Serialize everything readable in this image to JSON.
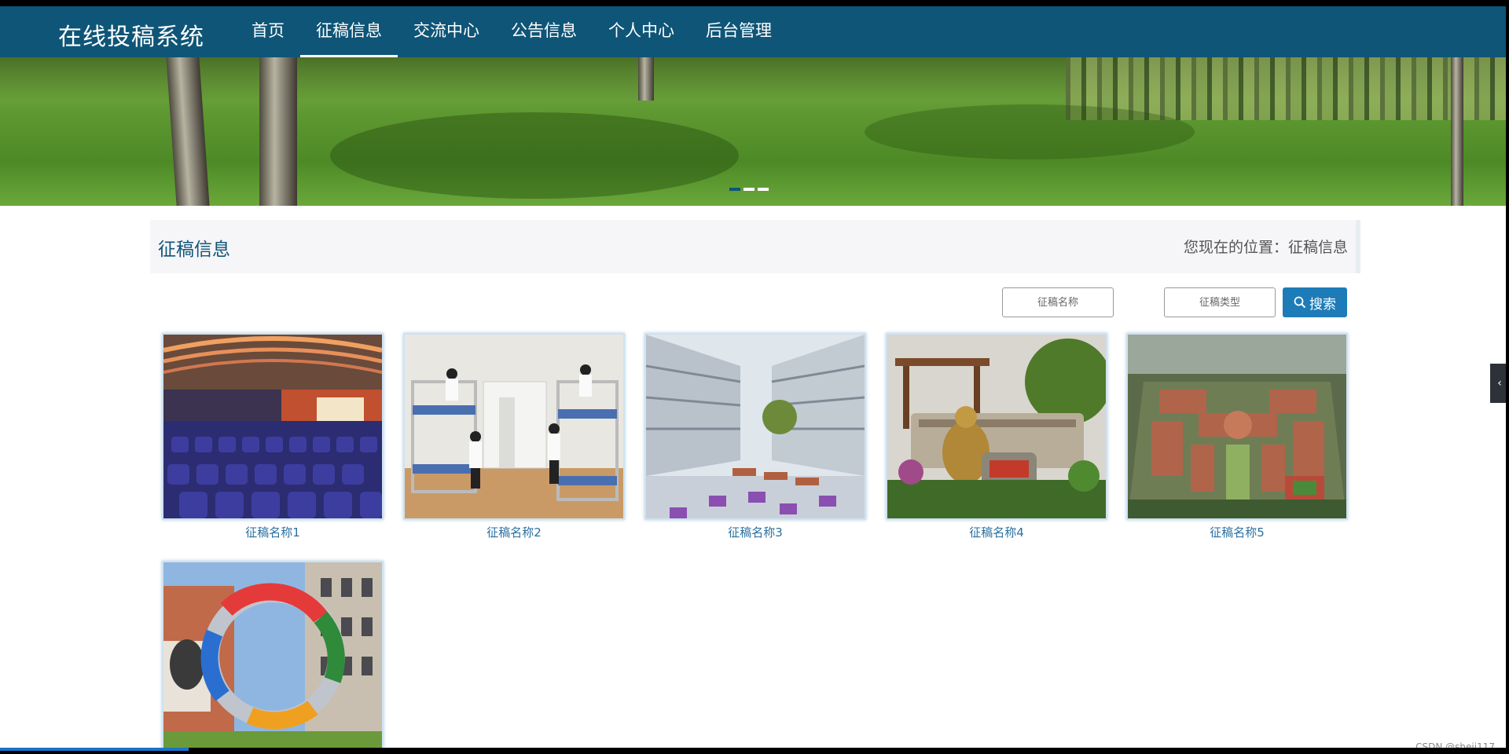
{
  "brand": "在线投稿系统",
  "nav": {
    "items": [
      {
        "label": "首页"
      },
      {
        "label": "征稿信息",
        "active": true
      },
      {
        "label": "交流中心"
      },
      {
        "label": "公告信息"
      },
      {
        "label": "个人中心"
      },
      {
        "label": "后台管理"
      }
    ]
  },
  "banner": {
    "slides": 3,
    "active_slide": 1
  },
  "section": {
    "title": "征稿信息",
    "location_prefix": "您现在的位置：",
    "location": "征稿信息"
  },
  "search": {
    "name_placeholder": "征稿名称",
    "type_placeholder": "征稿类型",
    "button_label": "搜索"
  },
  "cards": [
    {
      "label": "征稿名称1",
      "image": "auditorium"
    },
    {
      "label": "征稿名称2",
      "image": "dormitory"
    },
    {
      "label": "征稿名称3",
      "image": "school-courtyard"
    },
    {
      "label": "征稿名称4",
      "image": "sculpture-garden"
    },
    {
      "label": "征稿名称5",
      "image": "campus-aerial"
    },
    {
      "label": "",
      "image": "ring-sculpture"
    }
  ],
  "colors": {
    "primary": "#0f5577",
    "button": "#1d7cb8",
    "link": "#2a6fa0"
  },
  "side_tab_icon": "chevron-left-icon",
  "watermark": "CSDN @sheji117"
}
